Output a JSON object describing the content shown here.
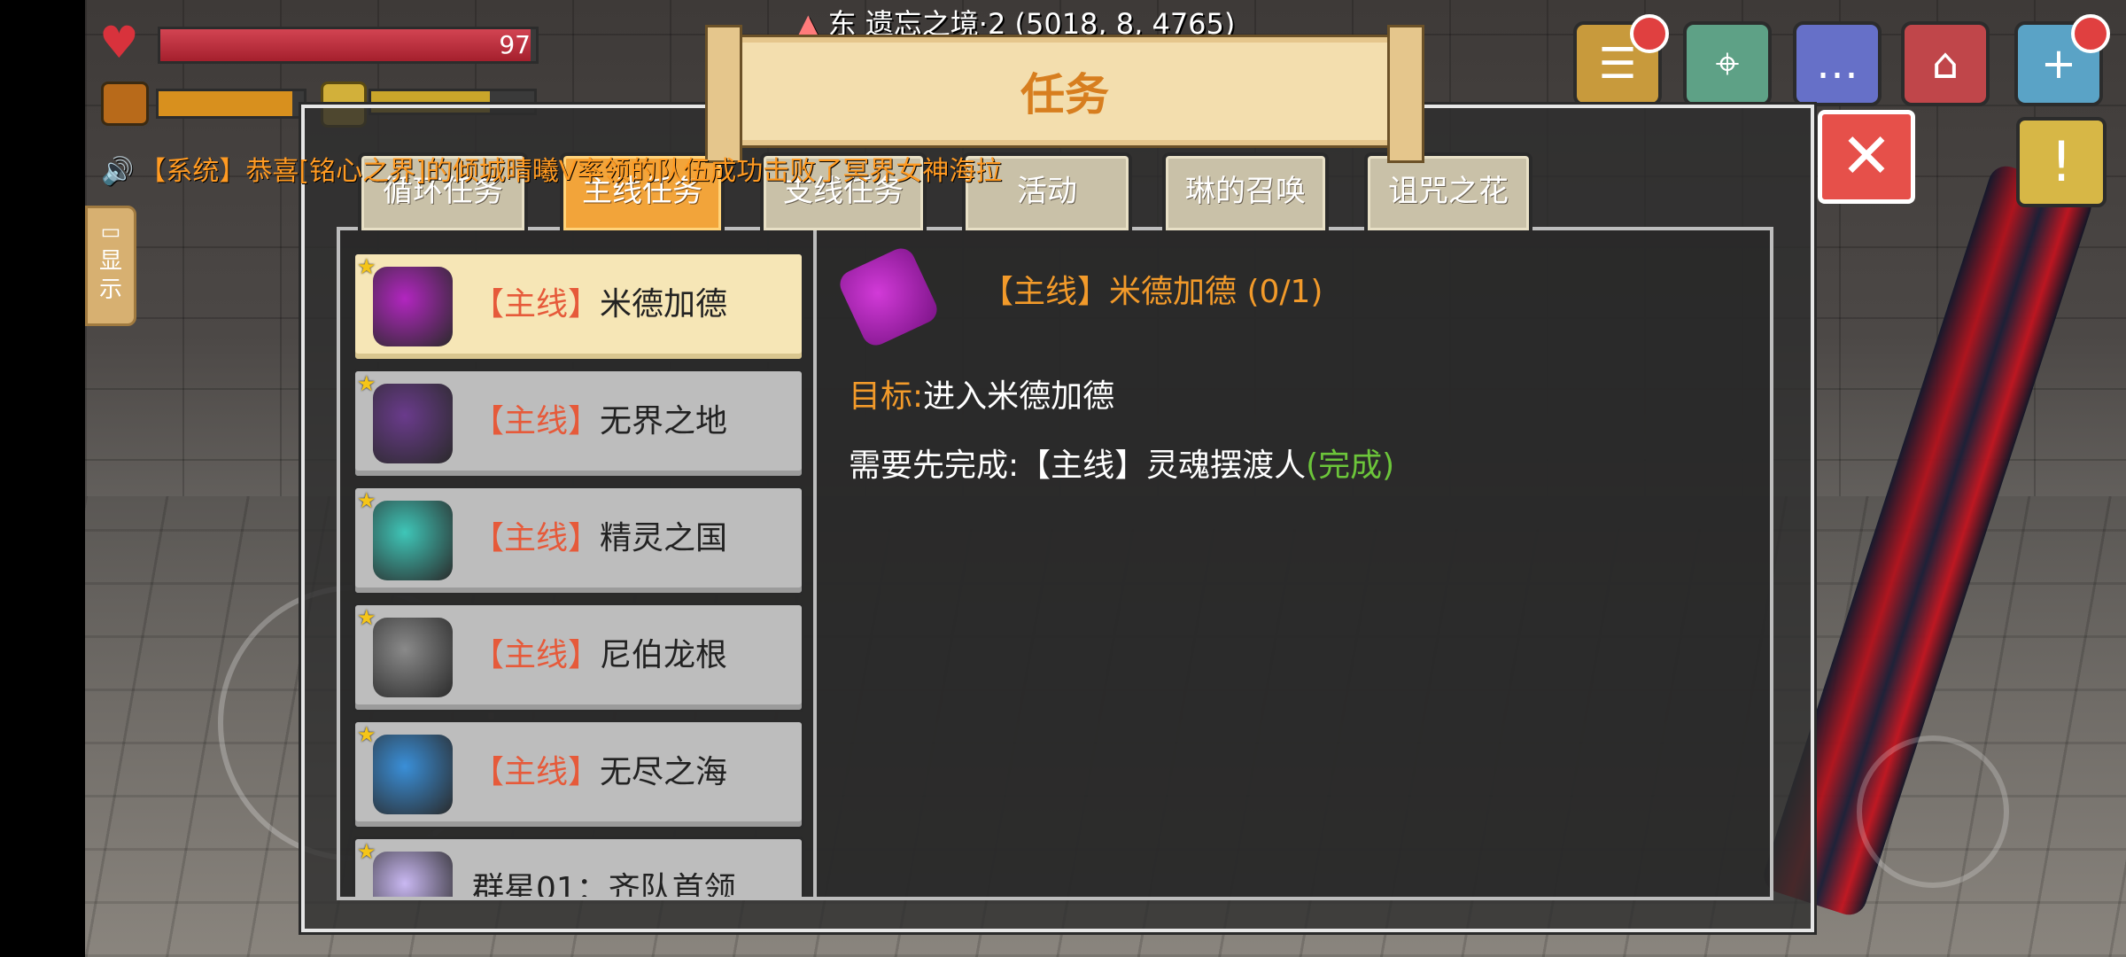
{
  "hud": {
    "health_value": "97",
    "health_fraction": 0.985,
    "food_fraction": 0.92,
    "stamina_fraction": 0.73,
    "location": "东  遗忘之境·2  (5018, 8, 4765)"
  },
  "top_buttons": [
    {
      "name": "quest-log-icon",
      "has_badge": true
    },
    {
      "name": "map-icon",
      "has_badge": false
    },
    {
      "name": "chat-icon",
      "has_badge": false
    },
    {
      "name": "shop-icon",
      "has_badge": false
    },
    {
      "name": "plus-icon",
      "has_badge": true
    }
  ],
  "side_tab": {
    "label": "显示"
  },
  "system_message": "【系统】恭喜[铭心之界]的倾城晴曦V率领的队伍成功击败了冥界女神海拉",
  "panel": {
    "title": "任务",
    "tabs": [
      {
        "label": "循环任务",
        "active": false
      },
      {
        "label": "主线任务",
        "active": true
      },
      {
        "label": "支线任务",
        "active": false
      },
      {
        "label": "活动",
        "active": false
      },
      {
        "label": "琳的召唤",
        "active": false
      },
      {
        "label": "诅咒之花",
        "active": false
      }
    ],
    "quests": [
      {
        "tag": "【主线】",
        "name": "米德加德",
        "icon": "purple-scroll-icon",
        "color": "#b226c0",
        "selected": true
      },
      {
        "tag": "【主线】",
        "name": "无界之地",
        "icon": "treasure-chest-icon",
        "color": "#6a3b8c",
        "selected": false
      },
      {
        "tag": "【主线】",
        "name": "精灵之国",
        "icon": "teal-scroll-icon",
        "color": "#3fc6b8",
        "selected": false
      },
      {
        "tag": "【主线】",
        "name": "尼伯龙根",
        "icon": "grey-scroll-icon",
        "color": "#8a8a8a",
        "selected": false
      },
      {
        "tag": "【主线】",
        "name": "无尽之海",
        "icon": "blue-scroll-icon",
        "color": "#3a8fd8",
        "selected": false
      },
      {
        "tag": "",
        "name": "群星01：齐队首领",
        "icon": "crystal-icon",
        "color": "#c9b8f2",
        "selected": false
      }
    ],
    "detail": {
      "title": "【主线】米德加德 (0/1)",
      "goal_key": "目标:",
      "goal_value": "进入米德加德",
      "req_text": "需要先完成:【主线】灵魂摆渡人",
      "req_status": "(完成)"
    }
  }
}
